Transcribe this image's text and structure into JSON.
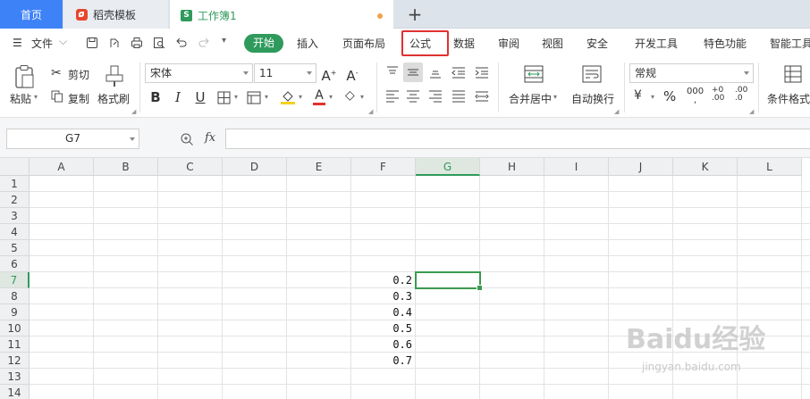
{
  "tabs": {
    "home": "首页",
    "template": "稻壳模板",
    "workbook": "工作簿1",
    "add": "+"
  },
  "menu": {
    "file": "文件",
    "start": "开始",
    "items": [
      "插入",
      "页面布局",
      "公式",
      "数据",
      "审阅",
      "视图",
      "安全",
      "开发工具",
      "特色功能",
      "智能工具"
    ]
  },
  "ribbon": {
    "paste": "粘贴",
    "cut": "剪切",
    "copy": "复制",
    "format_painter": "格式刷",
    "font_name": "宋体",
    "font_size": "11",
    "merge_center": "合并居中",
    "wrap_text": "自动换行",
    "number_format": "常规",
    "conditional_format": "条件格式"
  },
  "formula_bar": {
    "cell_ref": "G7",
    "fx": "fx",
    "formula": ""
  },
  "sheet": {
    "columns": [
      "A",
      "B",
      "C",
      "D",
      "E",
      "F",
      "G",
      "H",
      "I",
      "J",
      "K",
      "L"
    ],
    "active_column": "G",
    "rows": [
      "1",
      "2",
      "3",
      "4",
      "5",
      "6",
      "7",
      "8",
      "9",
      "10",
      "11",
      "12",
      "13",
      "14"
    ],
    "active_row": "7",
    "f_values": [
      {
        "row": "7",
        "value": "0.2"
      },
      {
        "row": "8",
        "value": "0.3"
      },
      {
        "row": "9",
        "value": "0.4"
      },
      {
        "row": "10",
        "value": "0.5"
      },
      {
        "row": "11",
        "value": "0.6"
      },
      {
        "row": "12",
        "value": "0.7"
      }
    ]
  },
  "watermark": {
    "logo": "Baidu经验",
    "url": "jingyan.baidu.com"
  },
  "colors": {
    "accent_green": "#2f9a5c",
    "home_tab_blue": "#3e82f7",
    "highlight_red": "#e03131"
  }
}
